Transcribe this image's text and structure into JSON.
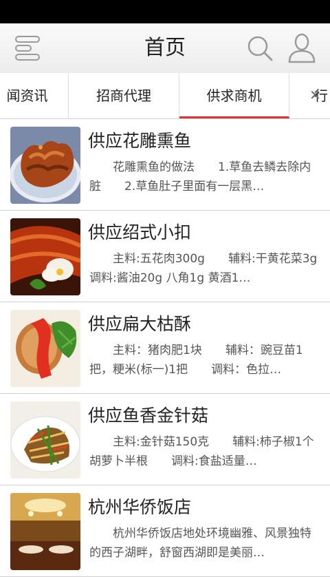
{
  "header": {
    "title": "首页",
    "menu_icon": "menu-icon",
    "search_icon": "search-icon",
    "user_icon": "user-icon"
  },
  "tabs": [
    {
      "label": "闻资讯"
    },
    {
      "label": "招商代理"
    },
    {
      "label": "供求商机"
    },
    {
      "label": "行"
    }
  ],
  "active_tab": "供求商机",
  "accent_color": "#e03030",
  "items": [
    {
      "title": "供应花雕熏鱼",
      "desc": "　　花雕熏鱼的做法　　1.草鱼去鳞去除内脏　　2.草鱼肚子里面有一层黑…"
    },
    {
      "title": "供应绍式小扣",
      "desc": "　　主料:五花肉300g　　辅料:干黄花菜3g　　调料:酱油20g 八角1g 黄酒1…"
    },
    {
      "title": "供应扁大枯酥",
      "desc": "　　主料：猪肉肥1块　　辅料：豌豆苗1把，粳米(标一)1把　　调料：色拉…"
    },
    {
      "title": "供应鱼香金针菇",
      "desc": "　　主料:金针菇150克　　辅料:柿子椒1个 胡萝卜半根　　调料:食盐适量…"
    },
    {
      "title": "杭州华侨饭店",
      "desc": "　　杭州华侨饭店地处环境幽雅、风景独特的西子湖畔，舒窗西湖即是美丽…"
    }
  ]
}
